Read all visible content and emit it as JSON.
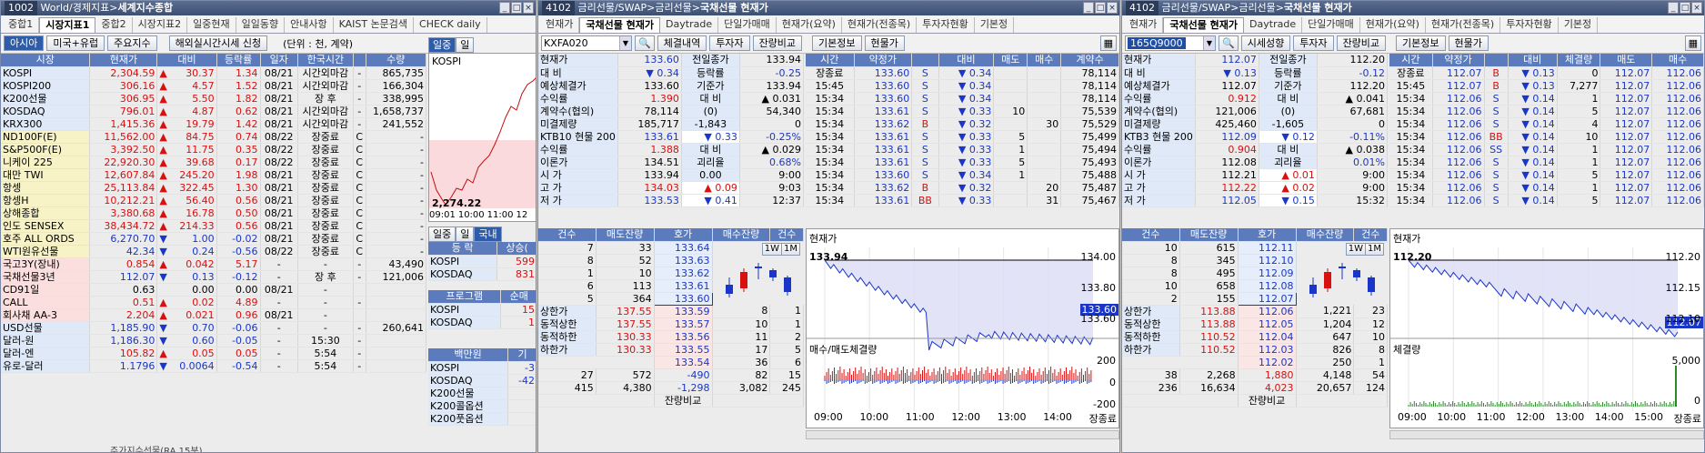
{
  "win1": {
    "title_num": "1002",
    "title_path": "World/경제지표",
    "title_main": "세계지수종합",
    "tabs": [
      "중합1",
      "시장지표1",
      "중합2",
      "시장지표2",
      "일중현재",
      "일일동향",
      "안내사항",
      "KAIST 논문검색",
      "CHECK daily"
    ],
    "active_tab": "시장지표1",
    "toolbar": {
      "btn1": "아시아",
      "btn2": "미국+유럽",
      "btn3": "주요지수",
      "btn4": "해외실시간시세 신청",
      "unit": "(단위 : 천, 계약)"
    },
    "columns": [
      "시장",
      "현재가",
      "대비",
      "등락률",
      "일자",
      "한국시간",
      "",
      "수량"
    ],
    "rows": [
      {
        "n": "KOSPI",
        "p": "2,304.59",
        "s": "▲",
        "c": "30.37",
        "r": "1.34",
        "d": "08/21",
        "t": "시간외마감",
        "f": "-",
        "v": "865,735",
        "dir": "up"
      },
      {
        "n": "KOSPI200",
        "p": "306.16",
        "s": "▲",
        "c": "4.57",
        "r": "1.52",
        "d": "08/21",
        "t": "시간외마감",
        "f": "-",
        "v": "166,304",
        "dir": "up"
      },
      {
        "n": "K200선물",
        "p": "306.95",
        "s": "▲",
        "c": "5.50",
        "r": "1.82",
        "d": "08/21",
        "t": "장 후",
        "f": "-",
        "v": "338,995",
        "dir": "up"
      },
      {
        "n": "KOSDAQ",
        "p": "796.01",
        "s": "▲",
        "c": "4.87",
        "r": "0.62",
        "d": "08/21",
        "t": "시간외마감",
        "f": "-",
        "v": "1,658,737",
        "dir": "up"
      },
      {
        "n": "KRX300",
        "p": "1,415.36",
        "s": "▲",
        "c": "19.79",
        "r": "1.42",
        "d": "08/21",
        "t": "시간외마감",
        "f": "-",
        "v": "241,552",
        "dir": "up"
      },
      {
        "n": "ND100F(E)",
        "p": "11,562.00",
        "s": "▲",
        "c": "84.75",
        "r": "0.74",
        "d": "08/22",
        "t": "장중료",
        "f": "C",
        "v": "-",
        "dir": "up"
      },
      {
        "n": "S&P500F(E)",
        "p": "3,392.50",
        "s": "▲",
        "c": "11.75",
        "r": "0.35",
        "d": "08/22",
        "t": "장중료",
        "f": "C",
        "v": "-",
        "dir": "up"
      },
      {
        "n": "니케이 225",
        "p": "22,920.30",
        "s": "▲",
        "c": "39.68",
        "r": "0.17",
        "d": "08/22",
        "t": "장중료",
        "f": "C",
        "v": "-",
        "dir": "up"
      },
      {
        "n": "대만 TWI",
        "p": "12,607.84",
        "s": "▲",
        "c": "245.20",
        "r": "1.98",
        "d": "08/21",
        "t": "장중료",
        "f": "C",
        "v": "-",
        "dir": "up"
      },
      {
        "n": "항셍",
        "p": "25,113.84",
        "s": "▲",
        "c": "322.45",
        "r": "1.30",
        "d": "08/21",
        "t": "장중료",
        "f": "C",
        "v": "-",
        "dir": "up"
      },
      {
        "n": "항셍H",
        "p": "10,212.21",
        "s": "▲",
        "c": "56.40",
        "r": "0.56",
        "d": "08/21",
        "t": "장중료",
        "f": "C",
        "v": "-",
        "dir": "up"
      },
      {
        "n": "상해종합",
        "p": "3,380.68",
        "s": "▲",
        "c": "16.78",
        "r": "0.50",
        "d": "08/21",
        "t": "장중료",
        "f": "C",
        "v": "-",
        "dir": "up"
      },
      {
        "n": "인도 SENSEX",
        "p": "38,434.72",
        "s": "▲",
        "c": "214.33",
        "r": "0.56",
        "d": "08/21",
        "t": "장중료",
        "f": "C",
        "v": "-",
        "dir": "up"
      },
      {
        "n": "호주 ALL ORDS",
        "p": "6,270.70",
        "s": "▼",
        "c": "1.00",
        "r": "-0.02",
        "d": "08/21",
        "t": "장중료",
        "f": "C",
        "v": "-",
        "dir": "dn"
      },
      {
        "n": "WTI원유선물",
        "p": "42.34",
        "s": "▼",
        "c": "0.24",
        "r": "-0.56",
        "d": "08/22",
        "t": "장중료",
        "f": "C",
        "v": "-",
        "dir": "dn"
      },
      {
        "n": "국고3Y(장내)",
        "p": "0.854",
        "s": "▲",
        "c": "0.042",
        "r": "5.17",
        "d": "-",
        "t": "-",
        "f": "-",
        "v": "43,490",
        "dir": "up"
      },
      {
        "n": "국채선물3년",
        "p": "112.07",
        "s": "▼",
        "c": "0.13",
        "r": "-0.12",
        "d": "-",
        "t": "장 후",
        "f": "-",
        "v": "121,006",
        "dir": "dn"
      },
      {
        "n": "CD91일",
        "p": "0.63",
        "s": "",
        "c": "0.00",
        "r": "0.00",
        "d": "08/21",
        "t": "-",
        "f": "",
        "v": "",
        "dir": ""
      },
      {
        "n": "CALL",
        "p": "0.51",
        "s": "▲",
        "c": "0.02",
        "r": "4.89",
        "d": "-",
        "t": "-",
        "f": "-",
        "v": "",
        "dir": "up"
      },
      {
        "n": "회사채 AA-3",
        "p": "2.204",
        "s": "▲",
        "c": "0.021",
        "r": "0.96",
        "d": "08/21",
        "t": "-",
        "f": "",
        "v": "",
        "dir": "up"
      },
      {
        "n": "USD선물",
        "p": "1,185.90",
        "s": "▼",
        "c": "0.70",
        "r": "-0.06",
        "d": "-",
        "t": "-",
        "f": "-",
        "v": "260,641",
        "dir": "dn"
      },
      {
        "n": "달러-원",
        "p": "1,186.30",
        "s": "▼",
        "c": "0.60",
        "r": "-0.05",
        "d": "-",
        "t": "15:30",
        "f": "-",
        "v": "",
        "dir": "dn"
      },
      {
        "n": "달러-엔",
        "p": "105.82",
        "s": "▲",
        "c": "0.05",
        "r": "0.05",
        "d": "-",
        "t": "5:54",
        "f": "-",
        "v": "",
        "dir": "up"
      },
      {
        "n": "유로-달러",
        "p": "1.1796",
        "s": "▼",
        "c": "0.0064",
        "r": "-0.54",
        "d": "-",
        "t": "5:54",
        "f": "-",
        "v": "",
        "dir": "dn"
      }
    ],
    "side": {
      "tab1": "일중",
      "tab2": "일",
      "chart_label": "KOSPI",
      "chart_last": "2,274.22",
      "times": [
        "09:01",
        "10:00",
        "11:00",
        "12"
      ],
      "tab3": "일중",
      "tab4": "일",
      "tab5": "국내",
      "t1_h1": "등 락",
      "t1_h2": "상승(",
      "t1_r1": "KOSPI",
      "t1_v1": "599",
      "t1_r2": "KOSDAQ",
      "t1_v2": "831",
      "t2_h1": "프로그램",
      "t2_h2": "순매",
      "t2_r1": "KOSPI",
      "t2_v1": "15",
      "t2_r2": "KOSDAQ",
      "t2_v2": "1",
      "t3_h1": "백만원",
      "t3_h2": "기",
      "t3_r1": "KOSPI",
      "t3_v1": "-3",
      "t3_r2": "KOSDAQ",
      "t3_v2": "-42",
      "t3_r3": "K200선물",
      "t3_v3": "",
      "t3_r4": "K200콜옵션",
      "t3_v4": "",
      "t3_r5": "K200풋옵션",
      "t3_v5": ""
    },
    "bottom": "주가지수선물(RA 15분)"
  },
  "win2": {
    "title_num": "4102",
    "title_path": "금리선물/SWAP>금리선물>",
    "title_main": "국채선물 현재가",
    "tabs": [
      "현재가",
      "국채선물 현재가",
      "Daytrade",
      "단일가매매",
      "현재가(요약)",
      "현재가(전종목)",
      "투자자현황",
      "기본정"
    ],
    "active_tab": "국채선물 현재가",
    "code": "KXFA020",
    "btns": [
      "체결내역",
      "투자자",
      "잔량비교",
      "기본정보",
      "현물가"
    ],
    "info": [
      [
        "현재가",
        "133.60",
        "전일종가",
        "133.94"
      ],
      [
        "대 비",
        "▼ 0.34",
        "등락률",
        "-0.25"
      ],
      [
        "예상체결가",
        "133.60",
        "기준가",
        "133.94"
      ],
      [
        "수익률",
        "1.390",
        "대 비",
        "▲ 0.031"
      ],
      [
        "계약수(협의)",
        "78,114",
        "(0)",
        "54,340"
      ],
      [
        "미결제량",
        "185,717",
        "-1,843",
        "0"
      ],
      [
        "KTB10 현물 200",
        "133.61",
        "▼ 0.33",
        "-0.25%"
      ],
      [
        "수익률",
        "1.388",
        "대 비",
        "▲ 0.029"
      ],
      [
        "이론가",
        "134.51",
        "괴리율",
        "0.68%"
      ],
      [
        "시 가",
        "133.94",
        "0.00",
        "9:00"
      ],
      [
        "고 가",
        "134.03",
        "▲ 0.09",
        "9:03"
      ],
      [
        "저 가",
        "133.53",
        "▼ 0.41",
        "12:37"
      ]
    ],
    "tick_cols": [
      "시간",
      "약정가",
      "",
      "대비",
      "매도",
      "매수",
      "계약수"
    ],
    "ticks": [
      [
        "장종료",
        "133.60",
        "S",
        "▼ 0.34",
        "",
        "",
        "78,114"
      ],
      [
        "15:45",
        "133.60",
        "S",
        "▼ 0.34",
        "",
        "",
        "78,114"
      ],
      [
        "15:34",
        "133.60",
        "S",
        "▼ 0.34",
        "",
        "",
        "78,114"
      ],
      [
        "15:34",
        "133.61",
        "S",
        "▼ 0.33",
        "10",
        "",
        "75,539"
      ],
      [
        "15:34",
        "133.62",
        "B",
        "▼ 0.32",
        "",
        "30",
        "75,529"
      ],
      [
        "15:34",
        "133.61",
        "S",
        "▼ 0.33",
        "5",
        "",
        "75,499"
      ],
      [
        "15:34",
        "133.61",
        "S",
        "▼ 0.33",
        "1",
        "",
        "75,494"
      ],
      [
        "15:34",
        "133.61",
        "S",
        "▼ 0.33",
        "5",
        "",
        "75,493"
      ],
      [
        "15:34",
        "133.60",
        "S",
        "▼ 0.34",
        "1",
        "",
        "75,488"
      ],
      [
        "15:34",
        "133.62",
        "B",
        "▼ 0.32",
        "",
        "20",
        "75,487"
      ],
      [
        "15:34",
        "133.61",
        "BB",
        "▼ 0.33",
        "",
        "31",
        "75,467"
      ]
    ],
    "ob_cols": [
      "건수",
      "매도잔량",
      "호가",
      "매수잔량",
      "건수"
    ],
    "asks": [
      [
        "7",
        "33",
        "133.64"
      ],
      [
        "8",
        "52",
        "133.63"
      ],
      [
        "1",
        "10",
        "133.62"
      ],
      [
        "6",
        "113",
        "133.61"
      ],
      [
        "5",
        "364",
        "133.60"
      ]
    ],
    "bids": [
      [
        "133.59",
        "8",
        "1"
      ],
      [
        "133.57",
        "10",
        "1"
      ],
      [
        "133.56",
        "11",
        "2"
      ],
      [
        "133.55",
        "17",
        "5"
      ],
      [
        "133.54",
        "36",
        "6"
      ]
    ],
    "limits": [
      [
        "상한가",
        "137.55"
      ],
      [
        "동적상한",
        "137.55"
      ],
      [
        "동적하한",
        "130.33"
      ],
      [
        "하한가",
        "130.33"
      ]
    ],
    "sum1": [
      "27",
      "572",
      "-490",
      "82",
      "15"
    ],
    "sum2": [
      "415",
      "4,380",
      "-1,298",
      "3,082",
      "245"
    ],
    "ob_footer": "잔량비교",
    "chart_title": "현재가",
    "chart_high": "133.94",
    "chart_last": "133.60",
    "yticks": [
      "134.00",
      "133.80",
      "133.60"
    ],
    "vol_title": "매수/매도체결량",
    "vol_yticks": [
      "200",
      "0",
      "-200"
    ],
    "xticks": [
      "09:00",
      "10:00",
      "11:00",
      "12:00",
      "13:00",
      "14:00",
      "장종료"
    ],
    "btn1w": "1W",
    "btn1m": "1M"
  },
  "win3": {
    "title_num": "4102",
    "title_path": "금리선물/SWAP>금리선물>",
    "title_main": "국채선물 현재가",
    "tabs": [
      "현재가",
      "국채선물 현재가",
      "Daytrade",
      "단일가매매",
      "현재가(요약)",
      "현재가(전종목)",
      "투자자현황",
      "기본정"
    ],
    "active_tab": "국채선물 현재가",
    "code": "165Q9000",
    "btns": [
      "시세성향",
      "투자자",
      "잔량비교",
      "기본정보",
      "현물가"
    ],
    "info": [
      [
        "현재가",
        "112.07",
        "전일종가",
        "112.20"
      ],
      [
        "대 비",
        "▼ 0.13",
        "등락률",
        "-0.12"
      ],
      [
        "예상체결가",
        "112.07",
        "기준가",
        "112.20"
      ],
      [
        "수익률",
        "0.912",
        "대 비",
        "▲ 0.041"
      ],
      [
        "계약수(협의)",
        "121,006",
        "(0)",
        "67,681"
      ],
      [
        "미결제량",
        "425,460",
        "-1,605",
        "0"
      ],
      [
        "KTB3 현물 200",
        "112.09",
        "▼ 0.12",
        "-0.11%"
      ],
      [
        "수익률",
        "0.904",
        "대 비",
        "▲ 0.038"
      ],
      [
        "이론가",
        "112.08",
        "괴리율",
        "0.01%"
      ],
      [
        "시 가",
        "112.21",
        "▲ 0.01",
        "9:00"
      ],
      [
        "고 가",
        "112.22",
        "▲ 0.02",
        "9:00"
      ],
      [
        "저 가",
        "112.05",
        "▼ 0.15",
        "15:32"
      ]
    ],
    "tick_cols": [
      "시간",
      "약정가",
      "",
      "대비",
      "체결량",
      "매도",
      "매수"
    ],
    "ticks": [
      [
        "장종료",
        "112.07",
        "B",
        "▼ 0.13",
        "0",
        "112.07",
        "112.06"
      ],
      [
        "15:45",
        "112.07",
        "B",
        "▼ 0.13",
        "7,277",
        "112.07",
        "112.06"
      ],
      [
        "15:34",
        "112.06",
        "S",
        "▼ 0.14",
        "1",
        "112.07",
        "112.06"
      ],
      [
        "15:34",
        "112.06",
        "S",
        "▼ 0.14",
        "5",
        "112.07",
        "112.06"
      ],
      [
        "15:34",
        "112.06",
        "S",
        "▼ 0.14",
        "4",
        "112.07",
        "112.06"
      ],
      [
        "15:34",
        "112.06",
        "BB",
        "▼ 0.14",
        "10",
        "112.07",
        "112.06"
      ],
      [
        "15:34",
        "112.06",
        "SS",
        "▼ 0.14",
        "1",
        "112.07",
        "112.06"
      ],
      [
        "15:34",
        "112.06",
        "S",
        "▼ 0.14",
        "1",
        "112.07",
        "112.06"
      ],
      [
        "15:34",
        "112.06",
        "S",
        "▼ 0.14",
        "5",
        "112.07",
        "112.06"
      ],
      [
        "15:34",
        "112.06",
        "S",
        "▼ 0.14",
        "1",
        "112.07",
        "112.06"
      ],
      [
        "15:34",
        "112.06",
        "S",
        "▼ 0.14",
        "5",
        "112.07",
        "112.06"
      ]
    ],
    "ob_cols": [
      "건수",
      "매도잔량",
      "호가",
      "매수잔량",
      "건수"
    ],
    "asks": [
      [
        "10",
        "615",
        "112.11"
      ],
      [
        "8",
        "345",
        "112.10"
      ],
      [
        "8",
        "495",
        "112.09"
      ],
      [
        "10",
        "658",
        "112.08"
      ],
      [
        "2",
        "155",
        "112.07"
      ]
    ],
    "bids": [
      [
        "112.06",
        "1,221",
        "23"
      ],
      [
        "112.05",
        "1,204",
        "12"
      ],
      [
        "112.04",
        "647",
        "10"
      ],
      [
        "112.03",
        "826",
        "8"
      ],
      [
        "112.02",
        "250",
        "1"
      ]
    ],
    "limits": [
      [
        "상한가",
        "113.88"
      ],
      [
        "동적상한",
        "113.88"
      ],
      [
        "동적하한",
        "110.52"
      ],
      [
        "하한가",
        "110.52"
      ]
    ],
    "sum1": [
      "38",
      "2,268",
      "1,880",
      "4,148",
      "54"
    ],
    "sum2": [
      "236",
      "16,634",
      "4,023",
      "20,657",
      "124"
    ],
    "ob_footer": "잔량비교",
    "chart_title": "현재가",
    "chart_high": "112.20",
    "chart_last": "112.07",
    "yticks": [
      "112.20",
      "112.15",
      "112.10"
    ],
    "vol_title": "체결량",
    "vol_yticks": [
      "5,000",
      "0"
    ],
    "xticks": [
      "09:00",
      "10:00",
      "11:00",
      "12:00",
      "13:00",
      "14:00",
      "15:00",
      "장종료"
    ],
    "btn1w": "1W",
    "btn1m": "1M"
  },
  "colors": {
    "up": "#d81010",
    "down": "#1a36c8",
    "header": "#5b7bbd",
    "title": "#3c4f72",
    "highlight_code": "#1f4ea6"
  }
}
